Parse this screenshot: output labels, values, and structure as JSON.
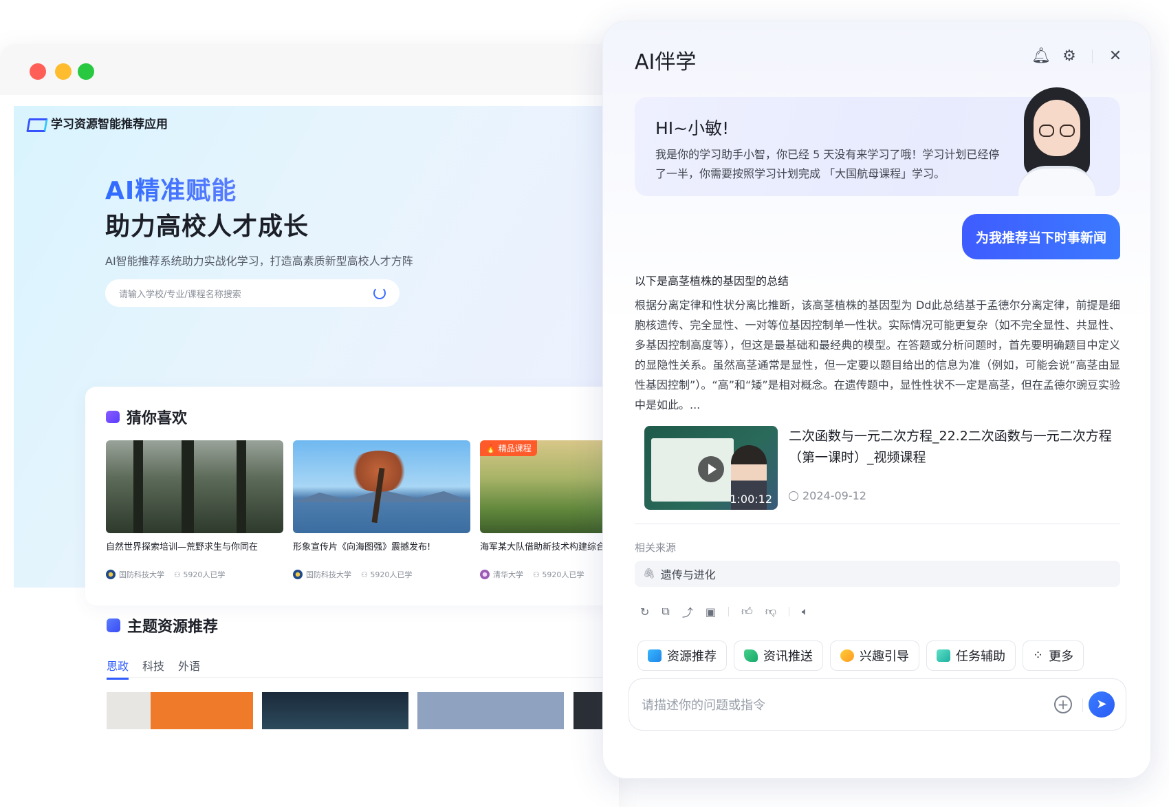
{
  "app": {
    "name": "学习资源智能推荐应用",
    "hero_title_1": "AI精准赋能",
    "hero_title_2": "助力高校人才成长",
    "hero_subtitle": "AI智能推荐系统助力实战化学习，打造高素质新型高校人才方阵",
    "search_placeholder": "请输入学校/专业/课程名称搜索"
  },
  "guess": {
    "title": "猜你喜欢",
    "cards": [
      {
        "title": "自然世界探索培训—荒野求生与你同在",
        "university": "国防科技大学",
        "learners": "5920人已学",
        "badge": ""
      },
      {
        "title": "形象宣传片《向海图强》震撼发布!",
        "university": "国防科技大学",
        "learners": "5920人已学",
        "badge": ""
      },
      {
        "title": "海军某大队借助新技术构建综合台",
        "university": "清华大学",
        "learners": "5920人已学",
        "badge": "精品课程"
      }
    ]
  },
  "topics": {
    "title": "主题资源推荐",
    "tabs": [
      "思政",
      "科技",
      "外语"
    ],
    "active_tab": "思政"
  },
  "panel": {
    "title": "AI伴学",
    "greeting_hi": "HI~小敏!",
    "greeting_body": "我是你的学习助手小智，你已经 5 天没有来学习了哦！学习计划已经停了一半，你需要按照学习计划完成 「大国航母课程」学习。",
    "user_message": "为我推荐当下时事新闻",
    "answer_title": "以下是高茎植株的基因型的总结",
    "answer_body": "根据分离定律和性状分离比推断，该高茎植株的基因型为 Dd此总结基于孟德尔分离定律，前提是细胞核遗传、完全显性、一对等位基因控制单一性状。实际情况可能更复杂（如不完全显性、共显性、多基因控制高度等），但这是最基础和最经典的模型。在答题或分析问题时，首先要明确题目中定义的显隐性关系。虽然高茎通常是显性，但一定要以题目给出的信息为准（例如，可能会说“高茎由显性基因控制”）。“高”和“矮”是相对概念。在遗传题中，显性性状不一定是高茎，但在孟德尔豌豆实验中是如此。...",
    "video": {
      "title": "二次函数与一元二次方程_22.2二次函数与一元二次方程（第一课时）_视频课程",
      "duration": "1:00:12",
      "date": "2024-09-12"
    },
    "source_label": "相关来源",
    "source_item": "遗传与进化",
    "chips": [
      "资源推荐",
      "资讯推送",
      "兴趣引导",
      "任务辅助",
      "更多"
    ],
    "input_placeholder": "请描述你的问题或指令"
  },
  "colors": {
    "accent": "#3f5cff",
    "badge": "#ff5a2a",
    "traffic_red": "#ff5f57",
    "traffic_yellow": "#febc2e",
    "traffic_green": "#28c840"
  }
}
